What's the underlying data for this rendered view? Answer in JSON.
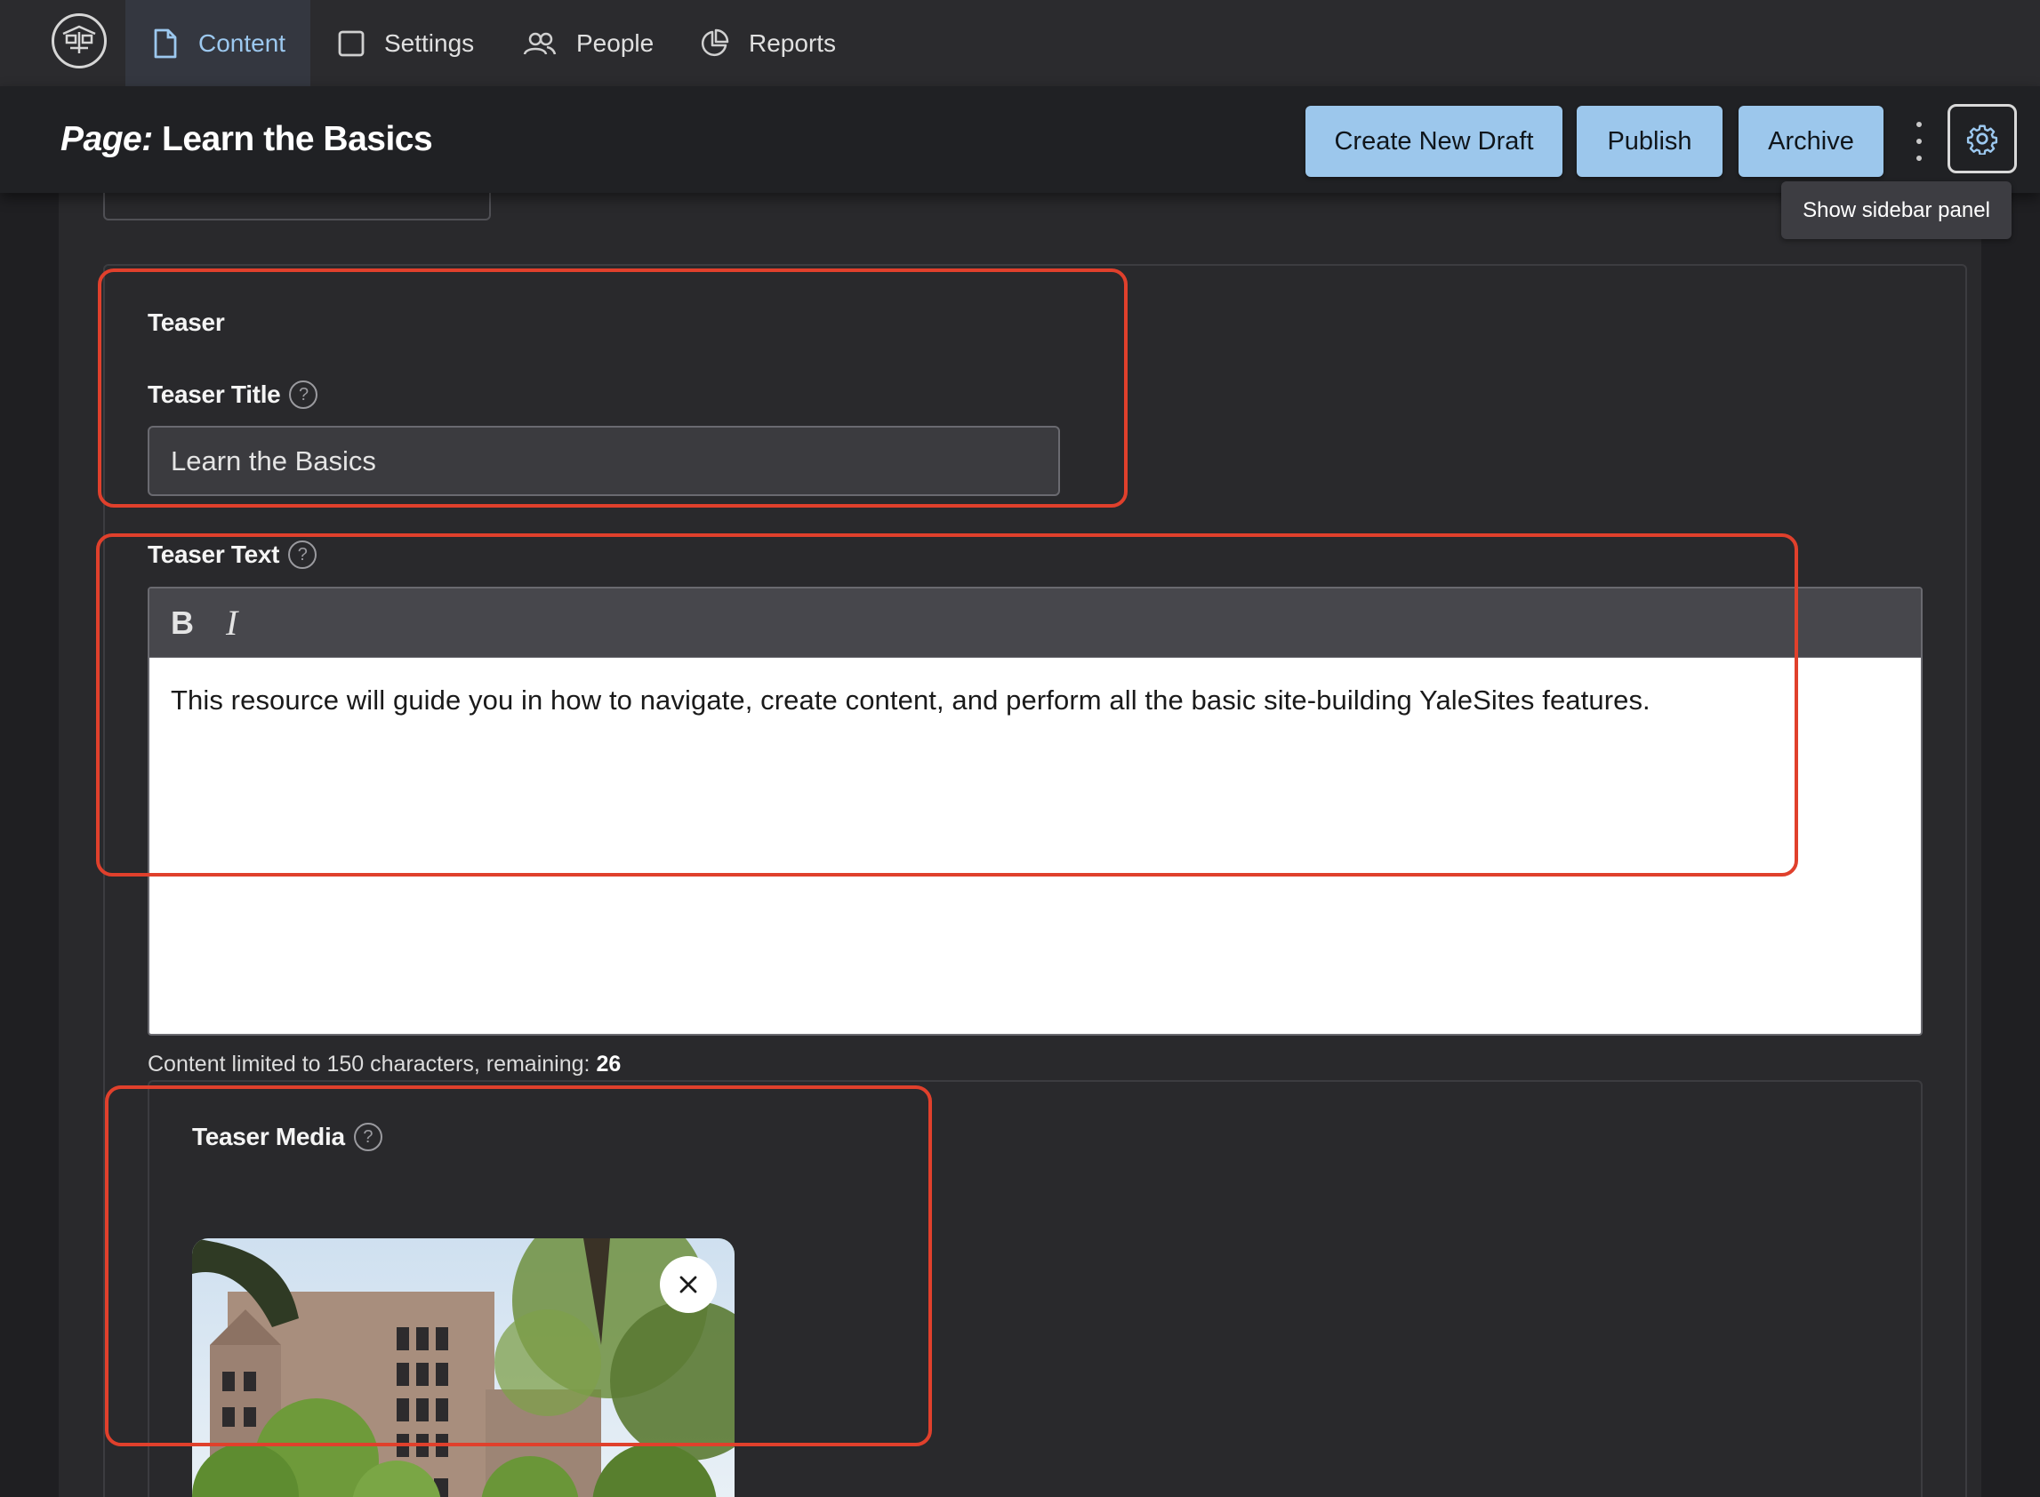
{
  "nav": {
    "items": [
      {
        "label": "Content",
        "icon": "document-icon",
        "active": true
      },
      {
        "label": "Settings",
        "icon": "square-icon",
        "active": false
      },
      {
        "label": "People",
        "icon": "people-icon",
        "active": false
      },
      {
        "label": "Reports",
        "icon": "pie-chart-icon",
        "active": false
      }
    ]
  },
  "header": {
    "title_prefix": "Page:",
    "title": "Learn the Basics",
    "buttons": {
      "create_draft": "Create New Draft",
      "publish": "Publish",
      "archive": "Archive"
    },
    "tooltip": "Show sidebar panel"
  },
  "form": {
    "section_title": "Teaser",
    "teaser_title": {
      "label": "Teaser Title",
      "value": "Learn the Basics"
    },
    "teaser_text": {
      "label": "Teaser Text",
      "toolbar": {
        "bold": "B",
        "italic": "I"
      },
      "value": "This resource will guide you in how to navigate, create content, and perform all the basic site-building YaleSites features."
    },
    "char_limit": {
      "prefix": "Content limited to 150 characters, remaining:",
      "remaining": "26"
    },
    "teaser_media": {
      "label": "Teaser Media",
      "help": "?"
    }
  },
  "help_glyph": "?",
  "colors": {
    "accent_button": "#9cc7ec",
    "active_nav": "#9cc8ef",
    "annotation": "#e0402c",
    "background": "#29292c"
  }
}
